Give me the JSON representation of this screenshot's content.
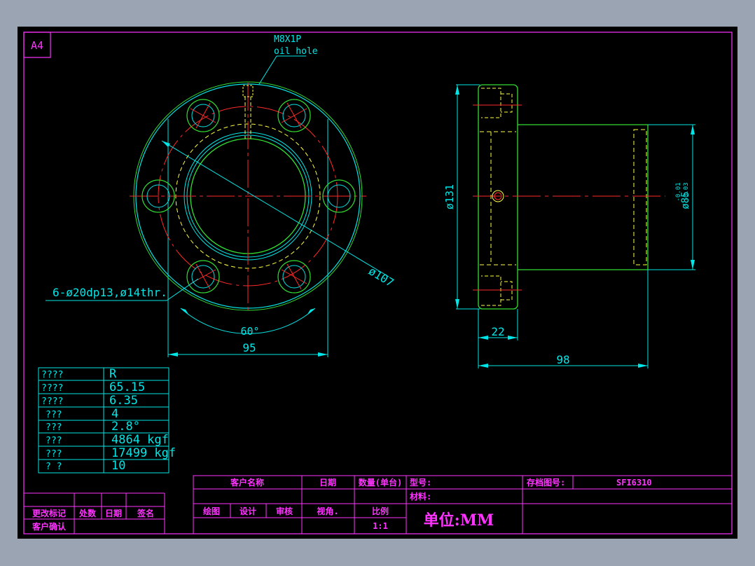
{
  "sheet": {
    "size_label": "A4"
  },
  "annotations": {
    "thread_label": "M8X1P",
    "oil_hole_label": "oil hole",
    "diameter_107": "ø107",
    "hole_spec": "6-ø20dp13,ø14thr.",
    "angle_label": "60°",
    "width_95": "95",
    "diameter_131": "ø131",
    "diameter_85": "ø85",
    "tol_upper": "-0.01",
    "tol_lower": "-0.03",
    "flange_thickness": "22",
    "overall_length": "98"
  },
  "param_table": {
    "rows": [
      {
        "label": "????",
        "value": "R"
      },
      {
        "label": "????",
        "value": "65.15"
      },
      {
        "label": "????",
        "value": "6.35"
      },
      {
        "label": "???",
        "value": "4"
      },
      {
        "label": "???",
        "value": "2.8°"
      },
      {
        "label": "???",
        "value": "4864  kgf"
      },
      {
        "label": "???",
        "value": "17499  kgf"
      },
      {
        "label": "?   ?",
        "value": "10"
      }
    ]
  },
  "title_block": {
    "customer_name": "客户名称",
    "date": "日期",
    "quantity": "数量(单台)",
    "model": "型号:",
    "archive_no": "存档图号:",
    "part_no": "SFI6310",
    "material": "材料:",
    "drawn": "绘图",
    "design": "设计",
    "review": "审核",
    "view_angle": "视角.",
    "scale_label": "比例",
    "scale_value": "1:1",
    "unit": "单位:MM"
  },
  "revision_block": {
    "change_mark": "更改标记",
    "location": "处数",
    "date": "日期",
    "signature": "签名",
    "customer_confirm": "客户确认"
  }
}
